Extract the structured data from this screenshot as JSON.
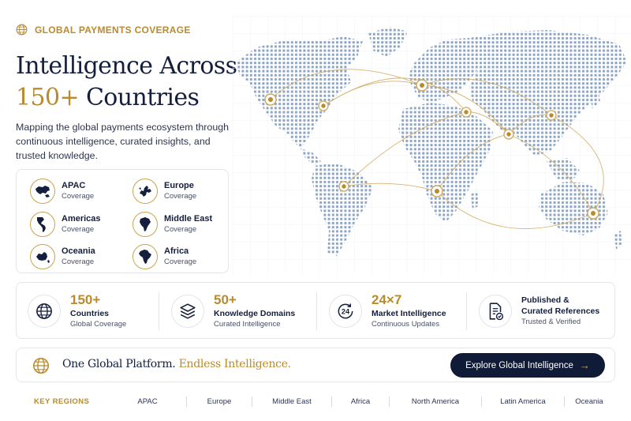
{
  "eyebrow": {
    "icon": "globe-icon",
    "text": "GLOBAL PAYMENTS COVERAGE"
  },
  "headline": {
    "line1": "Intelligence Across",
    "number": "150+",
    "line2_rest": "Countries"
  },
  "subtitle": "Mapping the global payments ecosystem through continuous intelligence, curated insights, and trusted knowledge.",
  "coverage": [
    {
      "name": "APAC",
      "sub": "Coverage",
      "icon": "apac-map-icon"
    },
    {
      "name": "Europe",
      "sub": "Coverage",
      "icon": "europe-map-icon"
    },
    {
      "name": "Americas",
      "sub": "Coverage",
      "icon": "americas-map-icon"
    },
    {
      "name": "Middle East",
      "sub": "Coverage",
      "icon": "middle-east-map-icon"
    },
    {
      "name": "Oceania",
      "sub": "Coverage",
      "icon": "oceania-map-icon"
    },
    {
      "name": "Africa",
      "sub": "Coverage",
      "icon": "africa-map-icon"
    }
  ],
  "stats": [
    {
      "value": "150+",
      "label": "Countries",
      "sub": "Global Coverage",
      "icon": "globe-icon"
    },
    {
      "value": "50+",
      "label": "Knowledge Domains",
      "sub": "Curated Intelligence",
      "icon": "layers-icon"
    },
    {
      "value": "24×7",
      "label": "Market Intelligence",
      "sub": "Continuous Updates",
      "icon": "clock-24-icon"
    },
    {
      "value": "",
      "label": "Published &",
      "label2": "Curated References",
      "sub": "Trusted & Verified",
      "icon": "document-check-icon"
    }
  ],
  "banner": {
    "text_primary": "One Global Platform.",
    "text_accent": "Endless Intelligence.",
    "cta_label": "Explore Global Intelligence",
    "cta_arrow": "→"
  },
  "regions": {
    "label": "KEY REGIONS",
    "items": [
      "APAC",
      "Europe",
      "Middle East",
      "Africa",
      "North America",
      "Latin America",
      "Oceania"
    ]
  },
  "colors": {
    "navy": "#141f3d",
    "gold": "#b98a2e",
    "map_dot": "#8ea5c4"
  }
}
